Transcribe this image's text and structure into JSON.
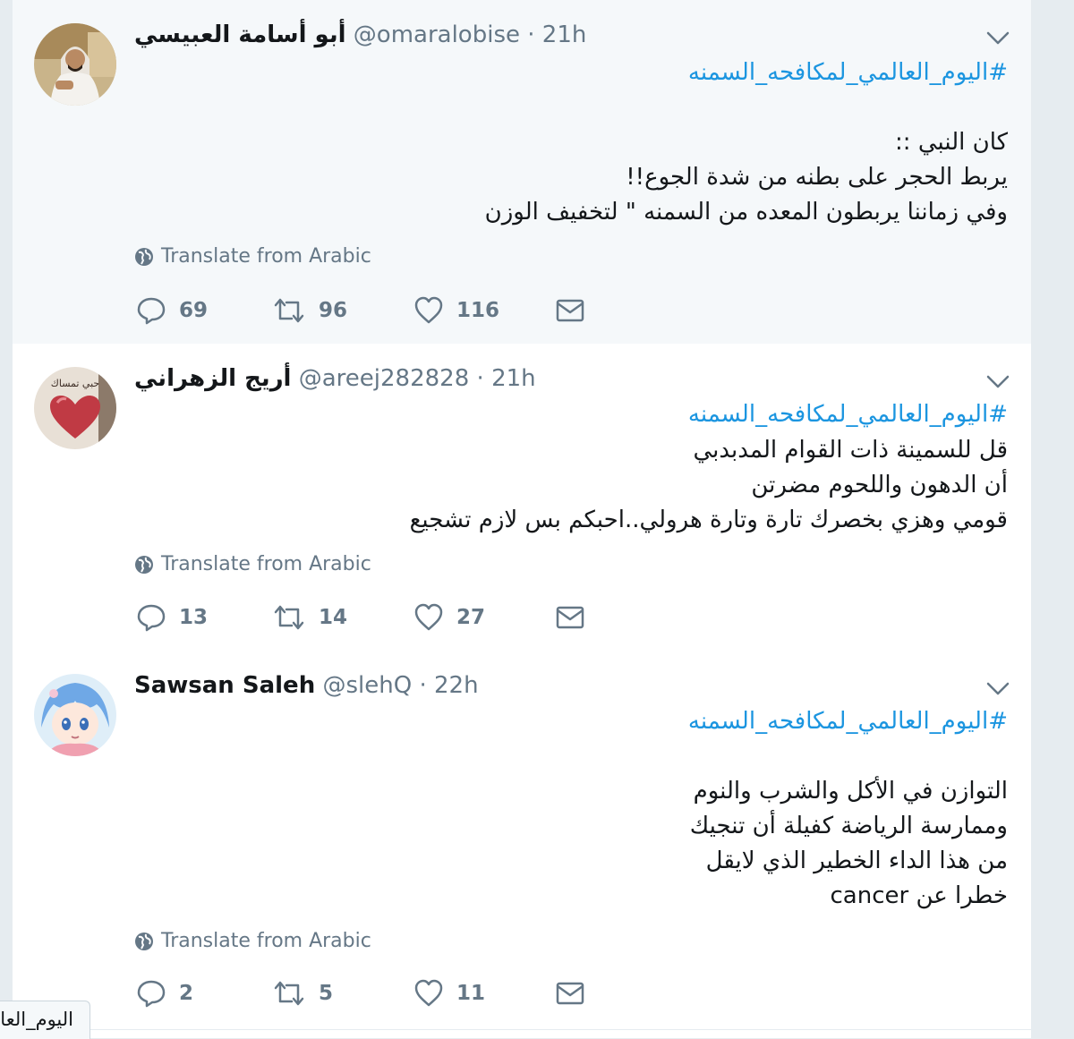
{
  "tweets": [
    {
      "fullname": "أبو أسامة العبيسي",
      "handle": "@omaralobise",
      "time": "21h",
      "hashtag": "#اليوم_العالمي_لمكافحه_السمنه",
      "text": "كان النبي  ::\nيربط الحجر على بطنه من شدة الجوع!!\nوفي زماننا يربطون المعده من السمنه \" لتخفيف الوزن",
      "translate": "Translate from Arabic",
      "replies": "69",
      "retweets": "96",
      "likes": "116"
    },
    {
      "fullname": "أريج الزهراني",
      "handle": "@areej282828",
      "time": "21h",
      "hashtag": "#اليوم_العالمي_لمكافحه_السمنه",
      "text": "قل للسمينة ذات القوام المدبدبي\nأن الدهون واللحوم مضرتن\nقومي وهزي بخصرك تارة وتارة هرولي..احبكم بس لازم تشجيع",
      "avatar_caption": "حبي تمساك",
      "translate": "Translate from Arabic",
      "replies": "13",
      "retweets": "14",
      "likes": "27"
    },
    {
      "fullname": "Sawsan Saleh",
      "handle": "@slehQ",
      "time": "22h",
      "hashtag": "#اليوم_العالمي_لمكافحه_السمنه",
      "text": "التوازن في الأكل والشرب والنوم\nوممارسة الرياضة كفيلة أن تنجيك\nمن هذا الداء الخطير الذي لايقل\nخطرا عن cancer",
      "translate": "Translate from Arabic",
      "replies": "2",
      "retweets": "5",
      "likes": "11"
    }
  ],
  "tooltip": {
    "text": "اليوم_العالمي"
  },
  "colors": {
    "link": "#1b95e0",
    "muted": "#657786",
    "text": "#14171a",
    "highlight_bg": "#f5f8fa",
    "page_bg": "#e6ecf0"
  }
}
